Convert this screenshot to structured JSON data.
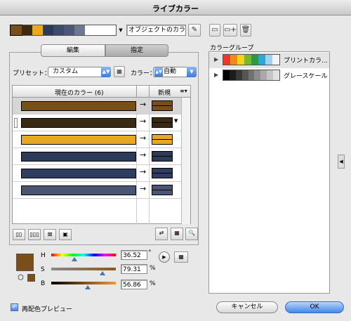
{
  "window": {
    "title": "ライブカラー"
  },
  "top": {
    "swatches": [
      "#7a4e1a",
      "#3a2a12",
      "#e8a81f",
      "#2d3b5a",
      "#3d4a6a",
      "#4d5878",
      "#6e7690"
    ],
    "object_colors_field": "オブジェクトのカラー"
  },
  "tabs": [
    {
      "label": "編集"
    },
    {
      "label": "指定"
    }
  ],
  "preset": {
    "label": "プリセット：",
    "value": "カスタム"
  },
  "colors": {
    "label": "カラー：",
    "value": "自動"
  },
  "table": {
    "current_header": "現在のカラー (6)",
    "new_header": "新規",
    "rows": [
      {
        "current": "#7a4e1a",
        "new": "#7a4e1a"
      },
      {
        "current": "#3a2a12",
        "new": "#3a2a12"
      },
      {
        "current": "#e8a81f",
        "new": "#e8a81f"
      },
      {
        "current": "#2d3b5a",
        "new": "#2d3b5a"
      },
      {
        "current": "#2f3d60",
        "new": "#2f3d60"
      },
      {
        "current": "#4a5574",
        "new": "#4a5574"
      }
    ]
  },
  "hsb": {
    "swatch": "#7a4e1a",
    "h": {
      "label": "H",
      "value": "36.52",
      "unit": "°",
      "level": 0.36
    },
    "s": {
      "label": "S",
      "value": "79.31",
      "unit": "%",
      "level": 0.79
    },
    "b": {
      "label": "B",
      "value": "56.86",
      "unit": "%",
      "level": 0.57
    }
  },
  "color_groups": {
    "label": "カラーグループ",
    "groups": [
      {
        "name": "プリントカラ...",
        "colors": [
          "#e63a2b",
          "#f08a1d",
          "#f7d21a",
          "#78b82a",
          "#2f9a3c",
          "#2aa9d6",
          "#9fd3ee",
          "#f5f5f5"
        ]
      },
      {
        "name": "グレースケール",
        "colors": [
          "#000000",
          "#1c1c1c",
          "#383838",
          "#555555",
          "#717171",
          "#8d8d8d",
          "#aaaaaa",
          "#c6c6c6",
          "#e2e2e2"
        ]
      }
    ]
  },
  "footer": {
    "recolor_preview": "再配色プレビュー",
    "cancel": "キャンセル",
    "ok": "OK"
  }
}
